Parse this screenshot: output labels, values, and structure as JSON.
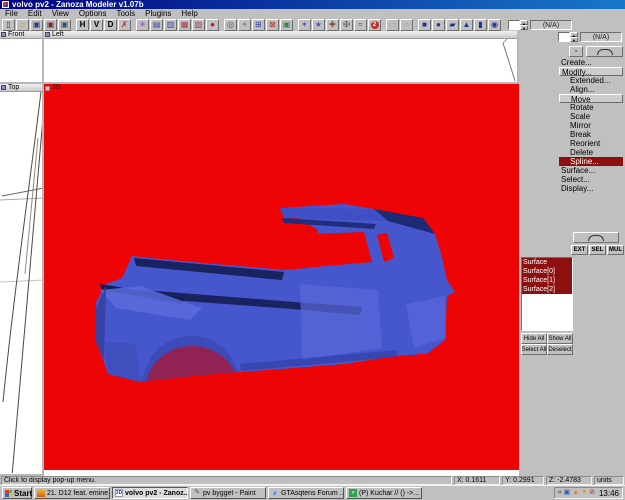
{
  "window": {
    "title": "volvo pv2 - Zanoza Modeler v1.07b"
  },
  "menu": {
    "items": [
      "File",
      "Edit",
      "View",
      "Options",
      "Tools",
      "Plugins",
      "Help"
    ]
  },
  "toolbar": {
    "na_label": "(N/A)",
    "icons": [
      {
        "name": "new-file-icon",
        "glyph": "▯",
        "color": "#334"
      },
      {
        "name": "open-folder-icon",
        "glyph": "▱",
        "color": "#c8a020"
      },
      {
        "name": "save-icon",
        "glyph": "▣",
        "color": "#283878"
      },
      {
        "name": "import-icon",
        "glyph": "▣",
        "color": "#7a2020"
      },
      {
        "name": "export-icon",
        "glyph": "▣",
        "color": "#20527a"
      },
      {
        "sep": true
      },
      {
        "name": "toggle-h-button",
        "glyph": "H",
        "color": "#000",
        "cls": "letter"
      },
      {
        "name": "toggle-v-button",
        "glyph": "V",
        "color": "#000",
        "cls": "letter"
      },
      {
        "name": "toggle-d-button",
        "glyph": "D",
        "color": "#000",
        "cls": "letter"
      },
      {
        "name": "snap-toggle-icon",
        "glyph": "✗",
        "color": "#b02020"
      },
      {
        "sep": true
      },
      {
        "name": "wireframe-mode-icon",
        "glyph": "✳",
        "color": "#8838b8"
      },
      {
        "name": "view-cube-front-icon",
        "glyph": "▤",
        "color": "#3848a8"
      },
      {
        "name": "view-cube-side-icon",
        "glyph": "▥",
        "color": "#3848a8"
      },
      {
        "name": "view-cube-top-icon",
        "glyph": "▦",
        "color": "#a83848"
      },
      {
        "name": "view-cube-persp-icon",
        "glyph": "▧",
        "color": "#a83848"
      },
      {
        "name": "render-sphere-icon",
        "glyph": "●",
        "color": "#c01818"
      },
      {
        "sep": true
      },
      {
        "name": "zoom-tool-icon",
        "glyph": "◎",
        "color": "#555"
      },
      {
        "name": "pick-tool-icon",
        "glyph": "✦",
        "color": "#888"
      },
      {
        "name": "object-cube-icon",
        "glyph": "⊞",
        "color": "#3848a8"
      },
      {
        "name": "delete-object-icon",
        "glyph": "⊠",
        "color": "#a83030"
      },
      {
        "name": "duplicate-icon",
        "glyph": "▣",
        "color": "#308050"
      },
      {
        "sep": true
      },
      {
        "name": "modify-star-icon",
        "glyph": "✶",
        "color": "#6a4ab0"
      },
      {
        "name": "create-star-icon",
        "glyph": "★",
        "color": "#4a5ab0"
      },
      {
        "name": "transform-icon",
        "glyph": "✚",
        "color": "#804a30"
      },
      {
        "name": "axes-icon",
        "glyph": "✠",
        "color": "#555"
      },
      {
        "name": "bend-tool-icon",
        "glyph": "≈",
        "color": "#3a6a3a"
      },
      {
        "name": "uv-mapper-icon",
        "glyph": "2",
        "color": "#fff",
        "cls": "uv"
      },
      {
        "sep": true
      },
      {
        "name": "disabled-rect-icon",
        "glyph": "▭",
        "color": "#9a9a9a",
        "disabled": true
      },
      {
        "name": "disabled-circle-icon",
        "glyph": "○",
        "color": "#9a9a9a",
        "disabled": true
      },
      {
        "sep": true
      },
      {
        "name": "primitive-cube-icon",
        "glyph": "■",
        "color": "#2030a0"
      },
      {
        "name": "primitive-sphere-icon",
        "glyph": "●",
        "color": "#2030a0"
      },
      {
        "name": "primitive-box-icon",
        "glyph": "▰",
        "color": "#2030a0"
      },
      {
        "name": "primitive-cone-icon",
        "glyph": "▲",
        "color": "#2030a0"
      },
      {
        "name": "primitive-cylinder-icon",
        "glyph": "▮",
        "color": "#2030a0"
      },
      {
        "name": "primitive-torus-icon",
        "glyph": "◉",
        "color": "#2030a0"
      }
    ]
  },
  "viewports": {
    "front": {
      "label": "Front"
    },
    "left": {
      "label": "Left"
    },
    "top": {
      "label": "Top"
    },
    "persp": {
      "label": "3D"
    }
  },
  "sidebar": {
    "na_label": "(N/A)",
    "commands": [
      {
        "label": "Create...",
        "name": "cmd-create",
        "indent": 0
      },
      {
        "label": "Modify...",
        "name": "cmd-modify",
        "indent": 0,
        "framed": true
      },
      {
        "label": "Extended...",
        "name": "cmd-extended",
        "indent": 1
      },
      {
        "label": "Align...",
        "name": "cmd-align",
        "indent": 1
      },
      {
        "label": "Move",
        "name": "cmd-move",
        "indent": 1,
        "framed": true
      },
      {
        "label": "Rotate",
        "name": "cmd-rotate",
        "indent": 1
      },
      {
        "label": "Scale",
        "name": "cmd-scale",
        "indent": 1
      },
      {
        "label": "Mirror",
        "name": "cmd-mirror",
        "indent": 1
      },
      {
        "label": "Break",
        "name": "cmd-break",
        "indent": 1
      },
      {
        "label": "Reorient",
        "name": "cmd-reorient",
        "indent": 1
      },
      {
        "label": "Delete",
        "name": "cmd-delete",
        "indent": 1
      },
      {
        "label": "Spline...",
        "name": "cmd-spline",
        "indent": 1,
        "selected": true
      },
      {
        "label": "Surface...",
        "name": "cmd-surface",
        "indent": 0
      },
      {
        "label": "Select...",
        "name": "cmd-select",
        "indent": 0
      },
      {
        "label": "Display...",
        "name": "cmd-display",
        "indent": 0
      }
    ],
    "mode_buttons": [
      "EXT",
      "SEL",
      "MUL"
    ],
    "surfaces": [
      "Surface",
      "Surface[0]",
      "Surface[1]",
      "Surface[2]"
    ],
    "list_buttons": [
      "Hide All",
      "Show All",
      "Select All",
      "Deselect"
    ]
  },
  "statusbar": {
    "message": "Click to display pop-up menu.",
    "x": "X: 0.1611",
    "y": "Y: 0.2991",
    "z": "Z: -2.4783",
    "units": "units"
  },
  "taskbar": {
    "start_label": "Start",
    "tasks": [
      {
        "name": "task-winamp",
        "icon": "winamp",
        "glyph": "",
        "label": "21. D12 feat. emine...",
        "active": false
      },
      {
        "name": "task-zmodeler",
        "icon": "zm",
        "glyph": "3D",
        "label": "volvo pv2 - Zanoz...",
        "active": true
      },
      {
        "name": "task-paint",
        "icon": "paint",
        "glyph": "✎",
        "label": "pv bygget - Paint",
        "active": false
      },
      {
        "name": "task-browser",
        "icon": "ie",
        "glyph": "e",
        "label": "GTAsqtens Forum ...",
        "active": false
      },
      {
        "name": "task-chat",
        "icon": "chat",
        "glyph": "»",
        "label": "(P) Kuchar // () -&gt;...",
        "active": false
      }
    ],
    "tray_icons": [
      {
        "name": "tray-collapse-icon",
        "glyph": "«",
        "color": "#333"
      },
      {
        "name": "tray-display-icon",
        "glyph": "▣",
        "color": "#2855c8"
      },
      {
        "name": "tray-app-icon",
        "glyph": "▲",
        "color": "#e08020"
      },
      {
        "name": "tray-messenger-icon",
        "glyph": "✦",
        "color": "#caa020"
      },
      {
        "name": "tray-blocked-icon",
        "glyph": "⊘",
        "color": "#cc2222"
      }
    ],
    "clock": "13:46"
  },
  "colors": {
    "viewport_bg": "#ee0404",
    "car_blue": "#4656cd",
    "car_dark_stripe": "#18235f",
    "selection_red": "#8c1010",
    "chrome_gray": "#c0c0c0",
    "titlebar_blue": "#000080"
  }
}
